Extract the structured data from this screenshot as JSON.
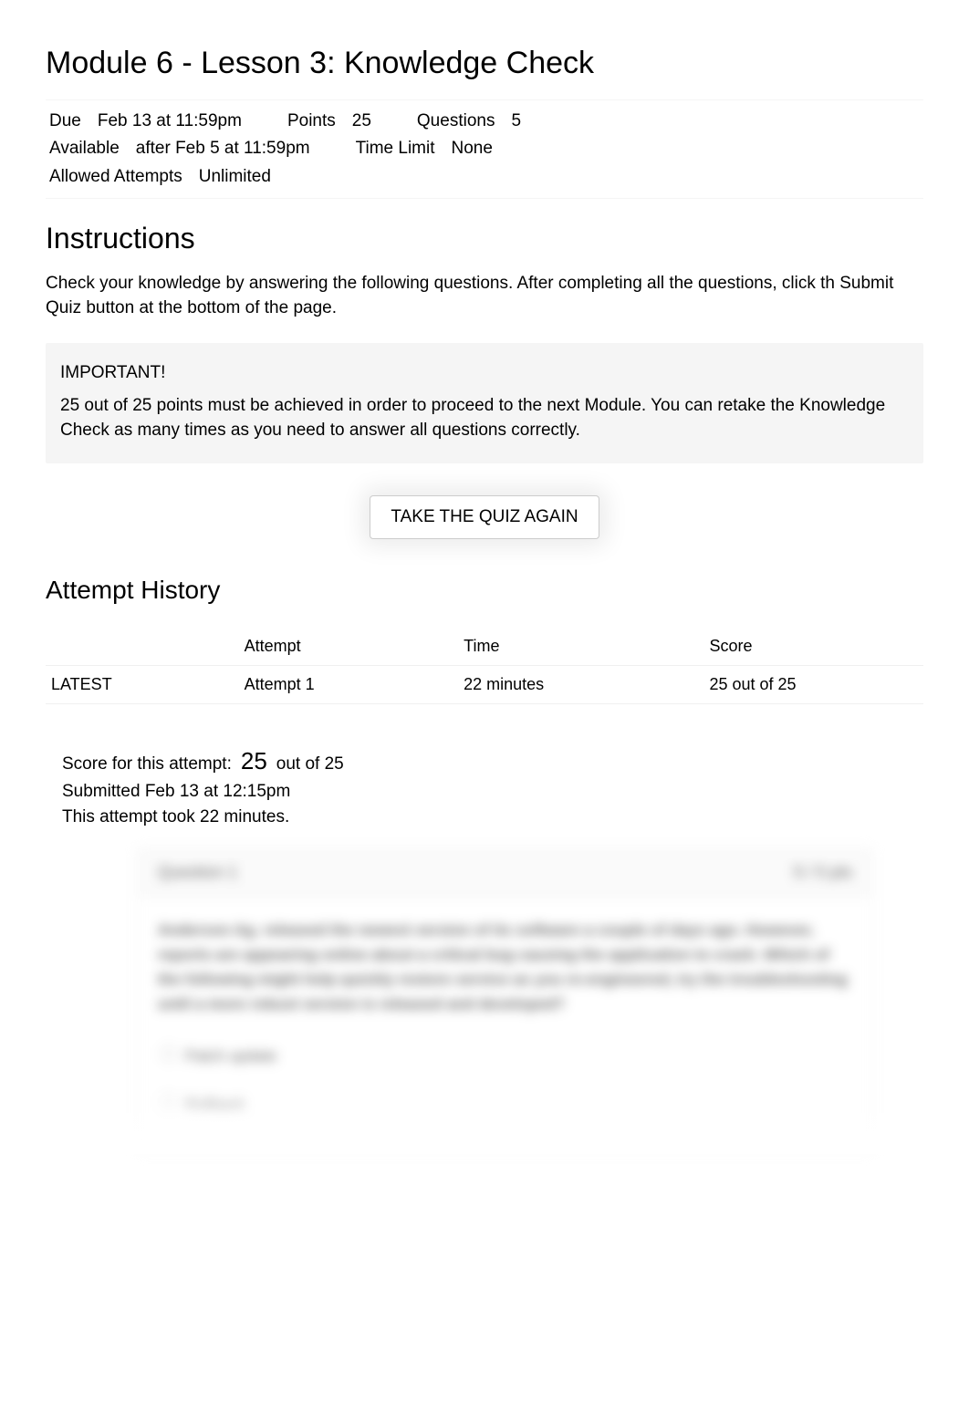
{
  "title": "Module 6 - Lesson 3: Knowledge Check",
  "meta": {
    "due_label": "Due",
    "due_value": "Feb 13 at 11:59pm",
    "points_label": "Points",
    "points_value": "25",
    "questions_label": "Questions",
    "questions_value": "5",
    "available_label": "Available",
    "available_value": "after Feb 5 at 11:59pm",
    "timelimit_label": "Time Limit",
    "timelimit_value": "None",
    "attempts_label": "Allowed Attempts",
    "attempts_value": "Unlimited"
  },
  "instructions": {
    "heading": "Instructions",
    "text": "Check your knowledge by answering the following questions. After completing all the questions, click th Submit Quiz button at the bottom of the page.",
    "important_heading": "IMPORTANT!",
    "important_text": "25 out of 25 points must be achieved in order to proceed to the next Module. You can retake the Knowledge Check as many times as you need to answer all questions correctly."
  },
  "take_quiz_label": "TAKE THE QUIZ AGAIN",
  "history": {
    "heading": "Attempt History",
    "headers": {
      "blank": "",
      "attempt": "Attempt",
      "time": "Time",
      "score": "Score"
    },
    "rows": [
      {
        "latest": "LATEST",
        "attempt": "Attempt 1",
        "time": "22 minutes",
        "score": "25 out of 25"
      }
    ]
  },
  "summary": {
    "score_label": "Score for this attempt:",
    "score_big": "25",
    "score_rest": "out of 25",
    "submitted": "Submitted Feb 13 at 12:15pm",
    "took": "This attempt took 22 minutes."
  },
  "question_preview": {
    "header_left": "Question 1",
    "header_right": "5 / 5 pts",
    "body": "Anderson Ag. released the newest version of its software a couple of days ago. However, reports are appearing online about a critical bug causing the application to crash. Which of the following might help quickly restore service as you re-engineered, try the troubleshooting until a more robust version is released and developed?",
    "answers": [
      "Patch update",
      "Rollback"
    ]
  }
}
